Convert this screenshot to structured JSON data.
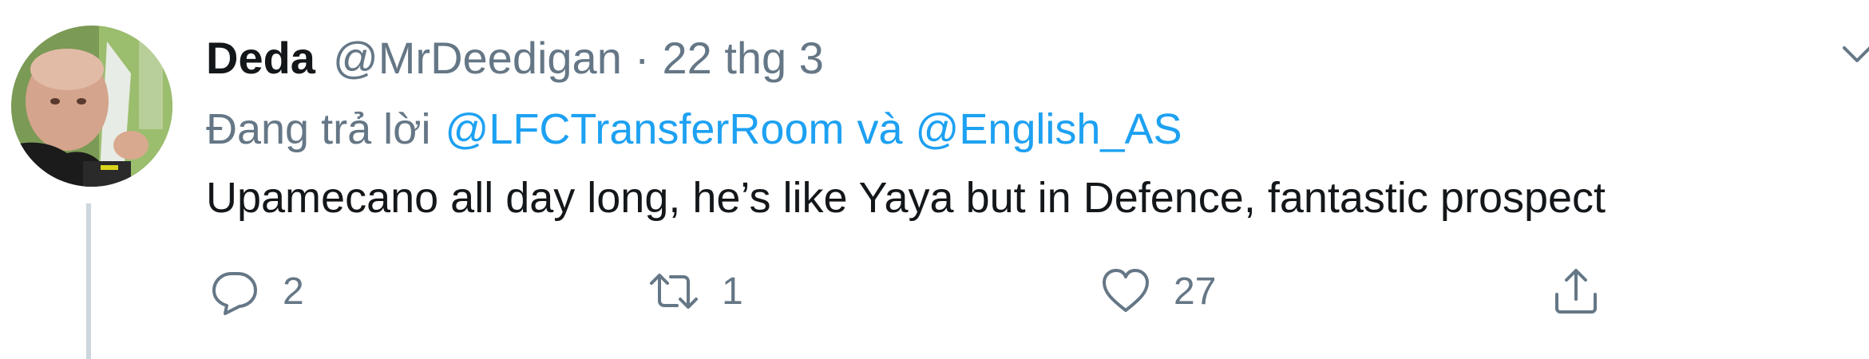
{
  "tweet": {
    "display_name": "Deda",
    "handle": "@MrDeedigan",
    "separator": "·",
    "timestamp": "22 thg 3",
    "reply_prefix": "Đang trả lời",
    "reply_to": [
      "@LFCTransferRoom",
      "@English_AS"
    ],
    "reply_conjunction": "và",
    "text": "Upamecano all day long, he’s like Yaya but in Defence, fantastic prospect"
  },
  "actions": {
    "reply_count": "2",
    "retweet_count": "1",
    "like_count": "27"
  },
  "icons": {
    "reply": "speech-bubble-icon",
    "retweet": "retweet-arrows-icon",
    "like": "heart-icon",
    "share": "share-upload-icon",
    "menu": "chevron-down-icon"
  },
  "colors": {
    "link": "#1da1f2",
    "muted": "#657786",
    "text": "#14171a",
    "thread_line": "#ccd6dd"
  }
}
